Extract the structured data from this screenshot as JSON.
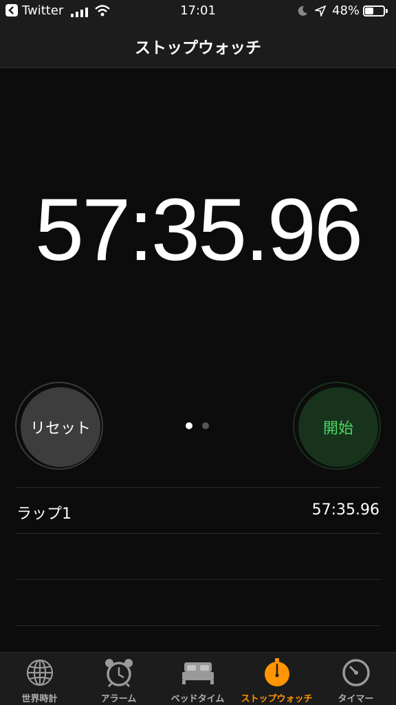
{
  "status_bar": {
    "back_app": "Twitter",
    "time": "17:01",
    "battery_percent": "48%",
    "battery_level": 0.48
  },
  "header": {
    "title": "ストップウォッチ"
  },
  "stopwatch": {
    "elapsed": "57:35.96"
  },
  "controls": {
    "reset_label": "リセット",
    "start_label": "開始",
    "accent_start": "#4cd964",
    "page_indicator": {
      "pages": 2,
      "current": 1
    }
  },
  "laps": [
    {
      "label": "ラップ1",
      "time": "57:35.96"
    }
  ],
  "tab_bar": {
    "items": [
      {
        "label": "世界時計",
        "icon": "globe-icon"
      },
      {
        "label": "アラーム",
        "icon": "alarm-clock-icon"
      },
      {
        "label": "ベッドタイム",
        "icon": "bed-icon"
      },
      {
        "label": "ストップウォッチ",
        "icon": "stopwatch-icon",
        "active": true
      },
      {
        "label": "タイマー",
        "icon": "timer-icon"
      }
    ],
    "active_color": "#ff9500"
  }
}
